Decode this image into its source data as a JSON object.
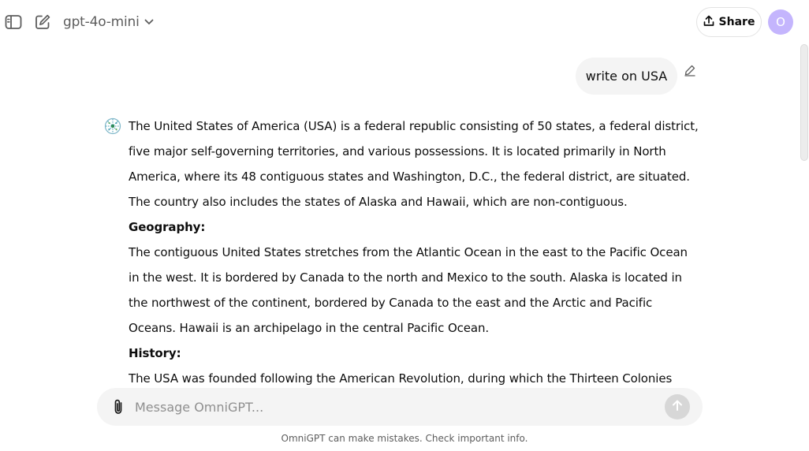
{
  "header": {
    "sidebar_toggle_icon": "sidebar-icon",
    "new_chat_icon": "edit-icon",
    "model_name": "gpt-4o-mini",
    "model_dropdown_icon": "chevron-down-icon",
    "share_label": "Share",
    "share_icon": "upload-icon",
    "avatar_initial": "O",
    "avatar_color": "#c4b5fd"
  },
  "conversation": {
    "user_message": "write on USA",
    "edit_icon": "pencil-icon",
    "assistant_icon": "omnigpt-logo-icon",
    "response": {
      "intro": "The United States of America (USA) is a federal republic consisting of 50 states, a federal district, five major self-governing territories, and various possessions. It is located primarily in North America, where its 48 contiguous states and Washington, D.C., the federal district, are situated. The country also includes the states of Alaska and Hawaii, which are non-contiguous.",
      "geography_heading": "Geography:",
      "geography_text": "The contiguous United States stretches from the Atlantic Ocean in the east to the Pacific Ocean in the west. It is bordered by Canada to the north and Mexico to the south. Alaska is located in the northwest of the continent, bordered by Canada to the east and the Arctic and Pacific Oceans. Hawaii is an archipelago in the central Pacific Ocean.",
      "history_heading": "History:",
      "history_text": "The USA was founded following the American Revolution, during which the Thirteen Colonies"
    }
  },
  "composer": {
    "placeholder": "Message OmniGPT...",
    "attach_icon": "paperclip-icon",
    "send_icon": "arrow-up-icon"
  },
  "footer": {
    "disclaimer": "OmniGPT can make mistakes. Check important info."
  }
}
